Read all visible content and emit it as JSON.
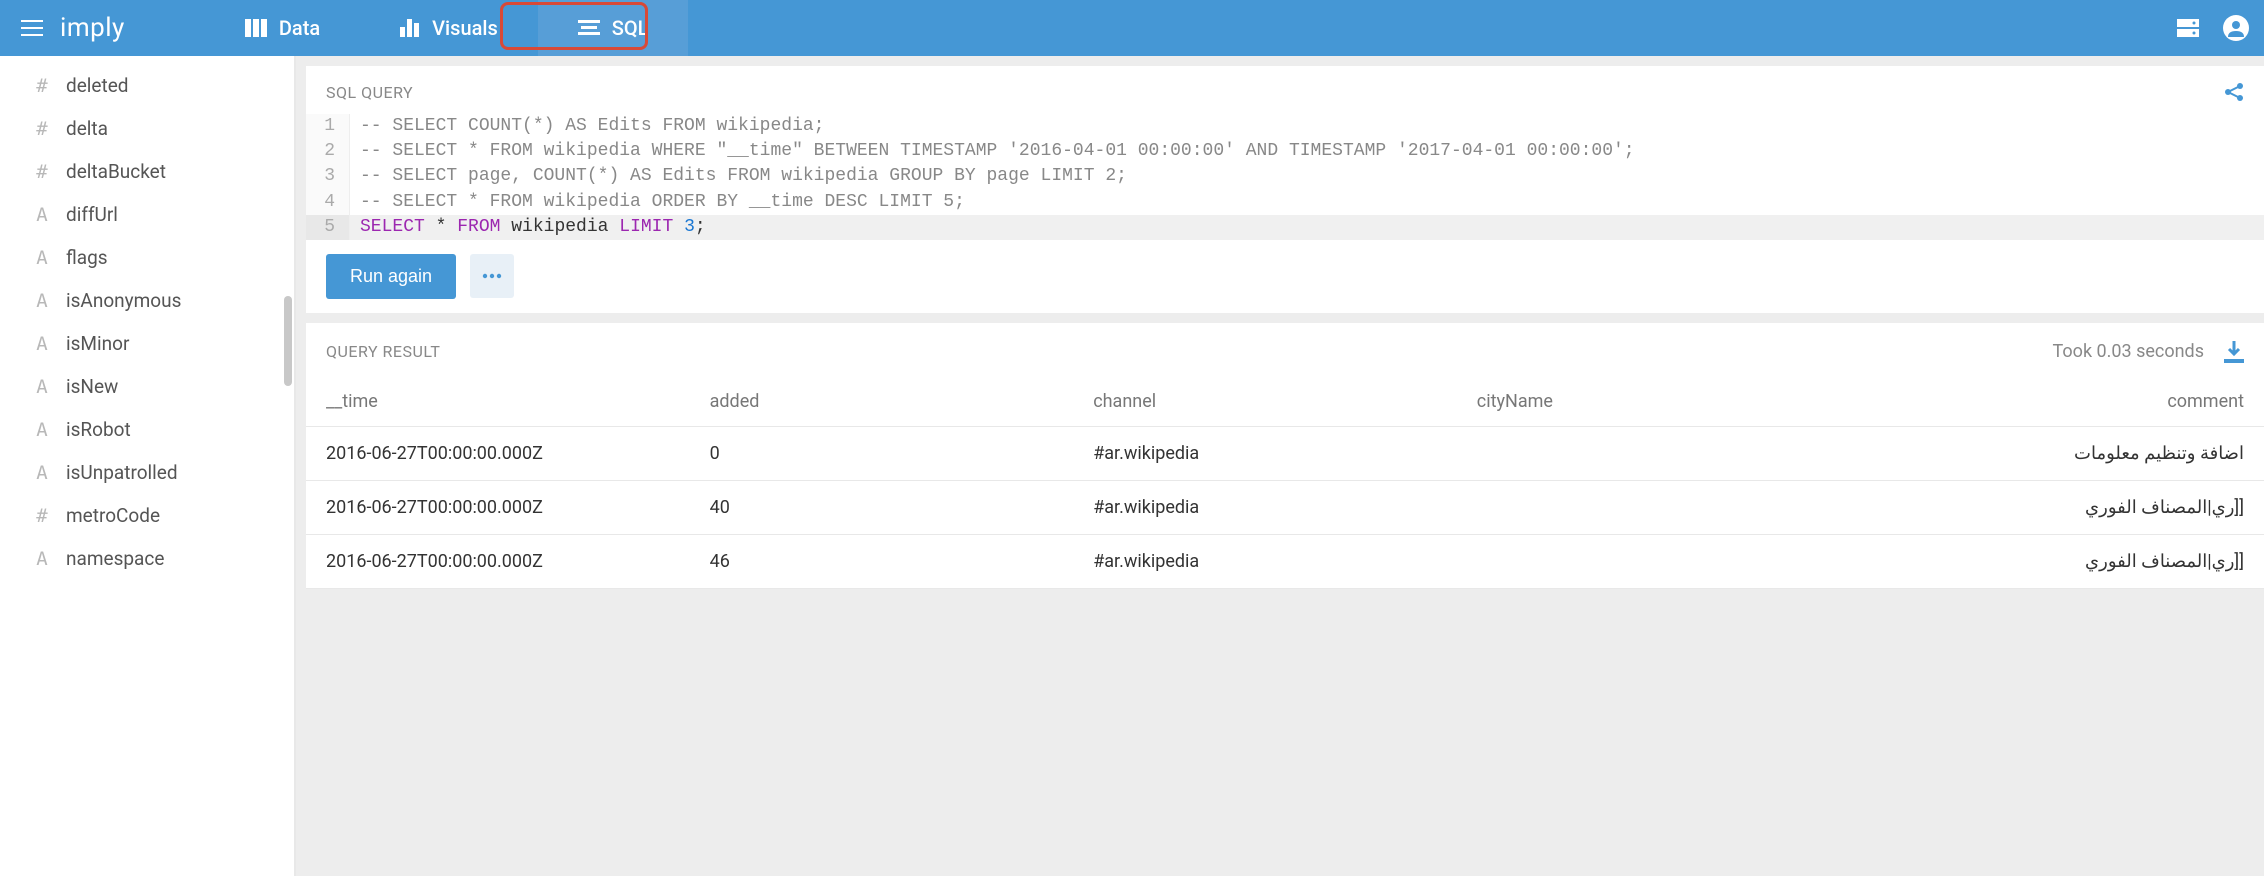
{
  "header": {
    "logo": "imply",
    "tabs": [
      {
        "label": "Data",
        "active": false
      },
      {
        "label": "Visuals",
        "active": false
      },
      {
        "label": "SQL",
        "active": true
      }
    ]
  },
  "sidebar": {
    "items": [
      {
        "icon": "#",
        "label": "deleted"
      },
      {
        "icon": "#",
        "label": "delta"
      },
      {
        "icon": "#",
        "label": "deltaBucket"
      },
      {
        "icon": "A",
        "label": "diffUrl"
      },
      {
        "icon": "A",
        "label": "flags"
      },
      {
        "icon": "A",
        "label": "isAnonymous"
      },
      {
        "icon": "A",
        "label": "isMinor"
      },
      {
        "icon": "A",
        "label": "isNew"
      },
      {
        "icon": "A",
        "label": "isRobot"
      },
      {
        "icon": "A",
        "label": "isUnpatrolled"
      },
      {
        "icon": "#",
        "label": "metroCode"
      },
      {
        "icon": "A",
        "label": "namespace"
      }
    ]
  },
  "query": {
    "title": "SQL QUERY",
    "lines": [
      {
        "n": "1",
        "comment": "-- SELECT COUNT(*) AS Edits FROM wikipedia;"
      },
      {
        "n": "2",
        "comment": "-- SELECT * FROM wikipedia WHERE \"__time\" BETWEEN TIMESTAMP '2016-04-01 00:00:00' AND TIMESTAMP '2017-04-01 00:00:00';"
      },
      {
        "n": "3",
        "comment": "-- SELECT page, COUNT(*) AS Edits FROM wikipedia GROUP BY page LIMIT 2;"
      },
      {
        "n": "4",
        "comment": "-- SELECT * FROM wikipedia ORDER BY __time DESC LIMIT 5;"
      },
      {
        "n": "5",
        "sql": {
          "k1": "SELECT",
          "star": " * ",
          "k2": "FROM",
          "tbl": " wikipedia ",
          "k3": "LIMIT",
          "sp": " ",
          "num": "3",
          "semi": ";"
        }
      }
    ],
    "run_label": "Run again"
  },
  "result": {
    "title": "QUERY RESULT",
    "timing": "Took 0.03 seconds",
    "columns": [
      "__time",
      "added",
      "channel",
      "cityName",
      "comment"
    ],
    "rows": [
      {
        "__time": "2016-06-27T00:00:00.000Z",
        "added": "0",
        "channel": "#ar.wikipedia",
        "cityName": "",
        "comment": "اضافة وتنظيم معلومات"
      },
      {
        "__time": "2016-06-27T00:00:00.000Z",
        "added": "40",
        "channel": "#ar.wikipedia",
        "cityName": "",
        "comment": "ري|المصناف الفوري]]"
      },
      {
        "__time": "2016-06-27T00:00:00.000Z",
        "added": "46",
        "channel": "#ar.wikipedia",
        "cityName": "",
        "comment": "ري|المصناف الفوري]]"
      }
    ]
  }
}
